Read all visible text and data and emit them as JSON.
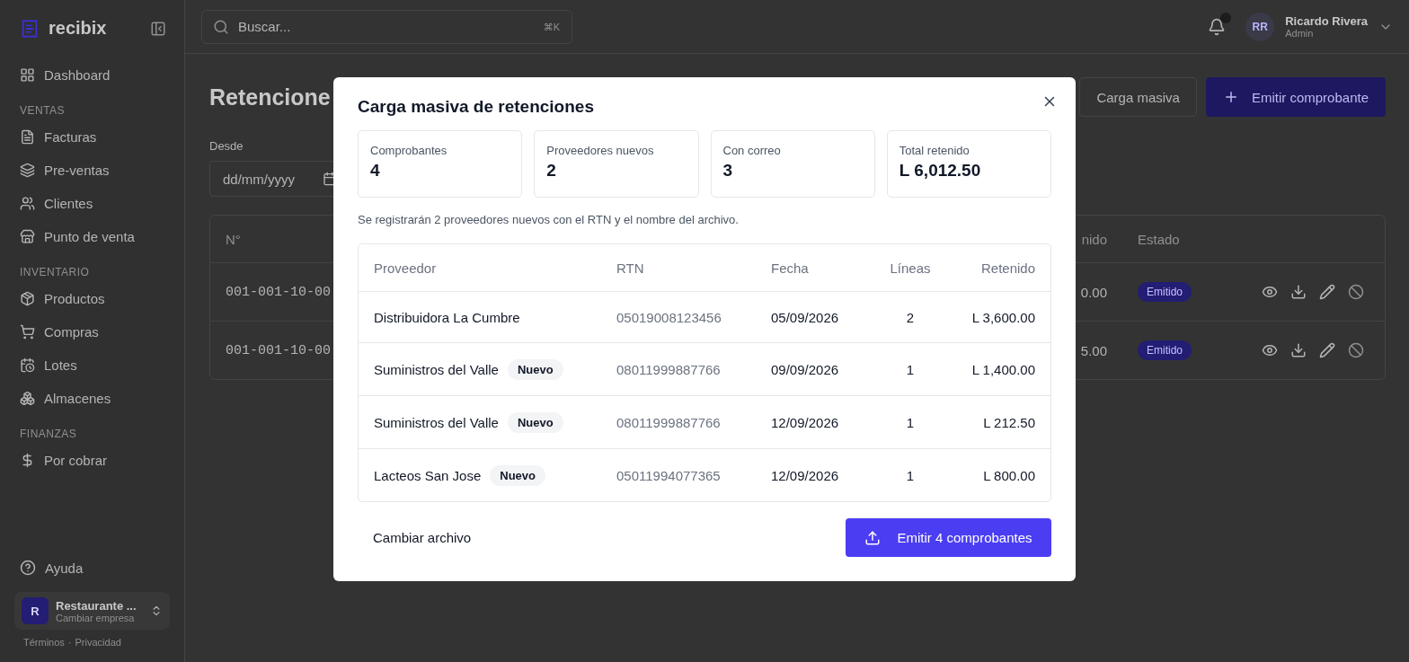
{
  "brand": {
    "name": "recibix"
  },
  "sidebar": {
    "sections": [
      {
        "items": [
          {
            "label": "Dashboard"
          }
        ]
      },
      {
        "heading": "VENTAS",
        "items": [
          {
            "label": "Facturas"
          },
          {
            "label": "Pre-ventas"
          },
          {
            "label": "Clientes"
          },
          {
            "label": "Punto de venta"
          }
        ]
      },
      {
        "heading": "INVENTARIO",
        "items": [
          {
            "label": "Productos"
          },
          {
            "label": "Compras"
          },
          {
            "label": "Lotes"
          },
          {
            "label": "Almacenes"
          }
        ]
      },
      {
        "heading": "FINANZAS",
        "items": [
          {
            "label": "Por cobrar"
          }
        ]
      }
    ],
    "help": "Ayuda",
    "company": {
      "initial": "R",
      "name": "Restaurante ...",
      "subtitle": "Cambiar empresa"
    },
    "footer_links": [
      "Términos",
      "Privacidad"
    ],
    "footer_separator": "·"
  },
  "topbar": {
    "search": {
      "placeholder": "Buscar...",
      "shortcut": "⌘K"
    },
    "user": {
      "initials": "RR",
      "name": "Ricardo Rivera",
      "role": "Admin"
    }
  },
  "page": {
    "title": "Retencione",
    "buttons": [
      {
        "kind": "outline",
        "label": "Carga masiva"
      },
      {
        "kind": "primary",
        "label": "Emitir comprobante"
      }
    ],
    "filter": {
      "label": "Desde",
      "placeholder": "dd/mm/yyyy"
    },
    "table": {
      "columns_left": [
        "N°"
      ],
      "columns_right": [
        "nido",
        "Estado"
      ],
      "rows": [
        {
          "number": "001-001-10-00",
          "amount": "0.00",
          "status": "Emitido"
        },
        {
          "number": "001-001-10-00",
          "amount": "5.00",
          "status": "Emitido"
        }
      ]
    }
  },
  "modal": {
    "title": "Carga masiva de retenciones",
    "stats": [
      {
        "label": "Comprobantes",
        "value": "4"
      },
      {
        "label": "Proveedores nuevos",
        "value": "2"
      },
      {
        "label": "Con correo",
        "value": "3"
      },
      {
        "label": "Total retenido",
        "value": "L 6,012.50"
      }
    ],
    "note": "Se registrarán 2 proveedores nuevos con el RTN y el nombre del archivo.",
    "table": {
      "columns": [
        "Proveedor",
        "RTN",
        "Fecha",
        "Líneas",
        "Retenido"
      ],
      "rows": [
        {
          "proveedor": "Distribuidora La Cumbre",
          "rtn": "05019008123456",
          "fecha": "05/09/2026",
          "lineas": "2",
          "retenido": "L 3,600.00"
        },
        {
          "proveedor": "Suministros del Valle",
          "badge": "Nuevo",
          "rtn": "08011999887766",
          "fecha": "09/09/2026",
          "lineas": "1",
          "retenido": "L 1,400.00"
        },
        {
          "proveedor": "Suministros del Valle",
          "badge": "Nuevo",
          "rtn": "08011999887766",
          "fecha": "12/09/2026",
          "lineas": "1",
          "retenido": "L 212.50"
        },
        {
          "proveedor": "Lacteos San Jose",
          "badge": "Nuevo",
          "rtn": "05011994077365",
          "fecha": "12/09/2026",
          "lineas": "1",
          "retenido": "L 800.00"
        }
      ]
    },
    "secondary_button": "Cambiar archivo",
    "primary_button": "Emitir 4 comprobantes"
  }
}
